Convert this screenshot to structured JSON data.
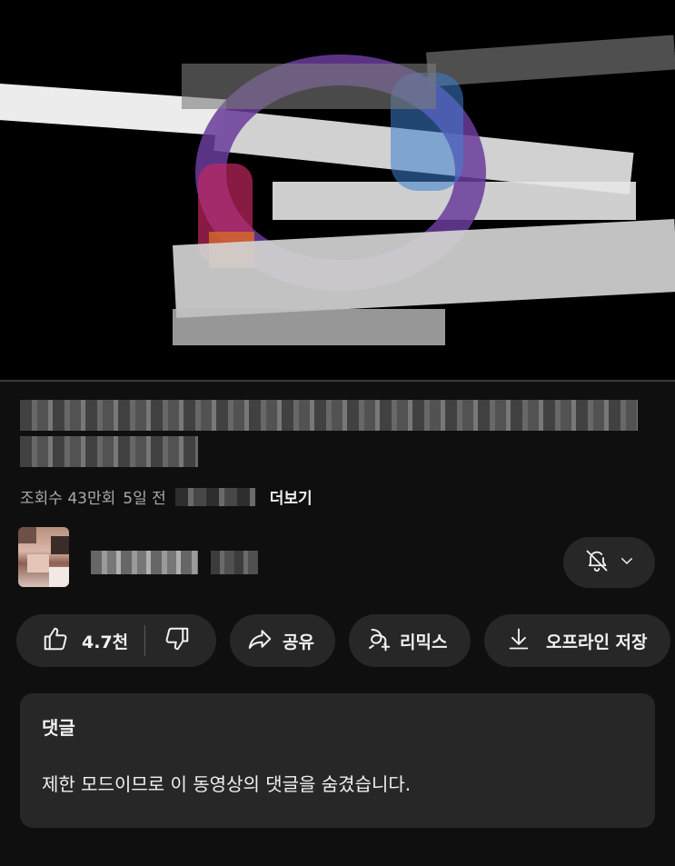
{
  "player": {
    "progress": 0.0
  },
  "video": {
    "views": "조회수 43만회",
    "age": "5일 전",
    "more_label": "더보기"
  },
  "actions": {
    "like_count": "4.7천",
    "share_label": "공유",
    "remix_label": "리믹스",
    "offline_label": "오프라인 저장"
  },
  "comments": {
    "title": "댓글",
    "message": "제한 모드이므로 이 동영상의 댓글을 숨겼습니다."
  },
  "icons": {
    "like": "thumbs-up-icon",
    "dislike": "thumbs-down-icon",
    "share": "share-arrow-icon",
    "remix": "remix-icon",
    "offline": "download-icon",
    "notify": "bell-off-icon",
    "dropdown": "chevron-down-icon"
  },
  "colors": {
    "background": "#0f0f0f",
    "surface": "#272727",
    "text_primary": "#f1f1f1",
    "text_secondary": "#aaaaaa"
  }
}
